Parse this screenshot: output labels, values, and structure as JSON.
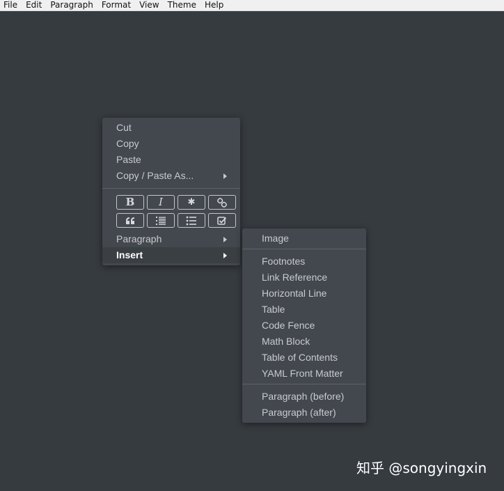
{
  "menubar": {
    "items": [
      "File",
      "Edit",
      "Paragraph",
      "Format",
      "View",
      "Theme",
      "Help"
    ]
  },
  "context_menu": {
    "items": [
      "Cut",
      "Copy",
      "Paste",
      "Copy / Paste As..."
    ],
    "format_buttons": [
      {
        "icon": "bold-icon",
        "glyph": "B"
      },
      {
        "icon": "italic-icon",
        "glyph": "I"
      },
      {
        "icon": "code-icon",
        "glyph": "✱"
      },
      {
        "icon": "link-icon",
        "glyph": "🔗"
      },
      {
        "icon": "quote-icon",
        "glyph": "❝"
      },
      {
        "icon": "ordered-list-icon",
        "glyph": "≡"
      },
      {
        "icon": "unordered-list-icon",
        "glyph": "≡"
      },
      {
        "icon": "task-list-icon",
        "glyph": "☑"
      }
    ],
    "paragraph_label": "Paragraph",
    "insert_label": "Insert"
  },
  "insert_submenu": {
    "image": "Image",
    "blocks": [
      "Footnotes",
      "Link Reference",
      "Horizontal Line",
      "Table",
      "Code Fence",
      "Math Block",
      "Table of Contents",
      "YAML Front Matter"
    ],
    "paragraph": [
      "Paragraph (before)",
      "Paragraph (after)"
    ]
  },
  "watermark": "知乎 @songyingxin",
  "colors": {
    "background": "#363b40",
    "menu_bg": "#43484e",
    "menu_text": "#c8cbcf"
  }
}
